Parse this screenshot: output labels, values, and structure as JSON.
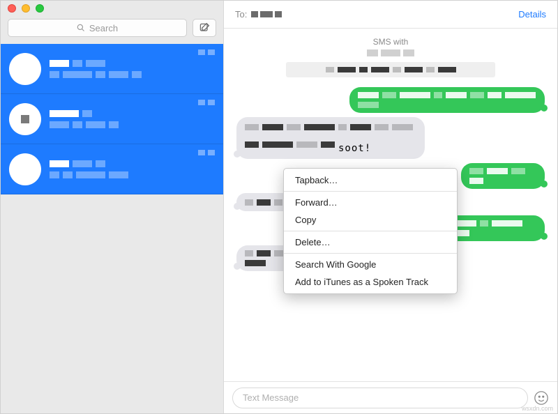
{
  "sidebar": {
    "search_placeholder": "Search",
    "compose_tooltip": "Compose",
    "conversations": [
      {
        "id": 0
      },
      {
        "id": 1
      },
      {
        "id": 2
      }
    ]
  },
  "header": {
    "to_label": "To:",
    "details_label": "Details"
  },
  "thread": {
    "sms_with_label": "SMS with",
    "selected_bubble_text": "soot!",
    "context_menu": {
      "tapback": "Tapback…",
      "forward": "Forward…",
      "copy": "Copy",
      "delete": "Delete…",
      "search_google": "Search With Google",
      "itunes_spoken": "Add to iTunes as a Spoken Track"
    }
  },
  "compose": {
    "placeholder": "Text Message"
  },
  "watermark": "wsxdn.com"
}
